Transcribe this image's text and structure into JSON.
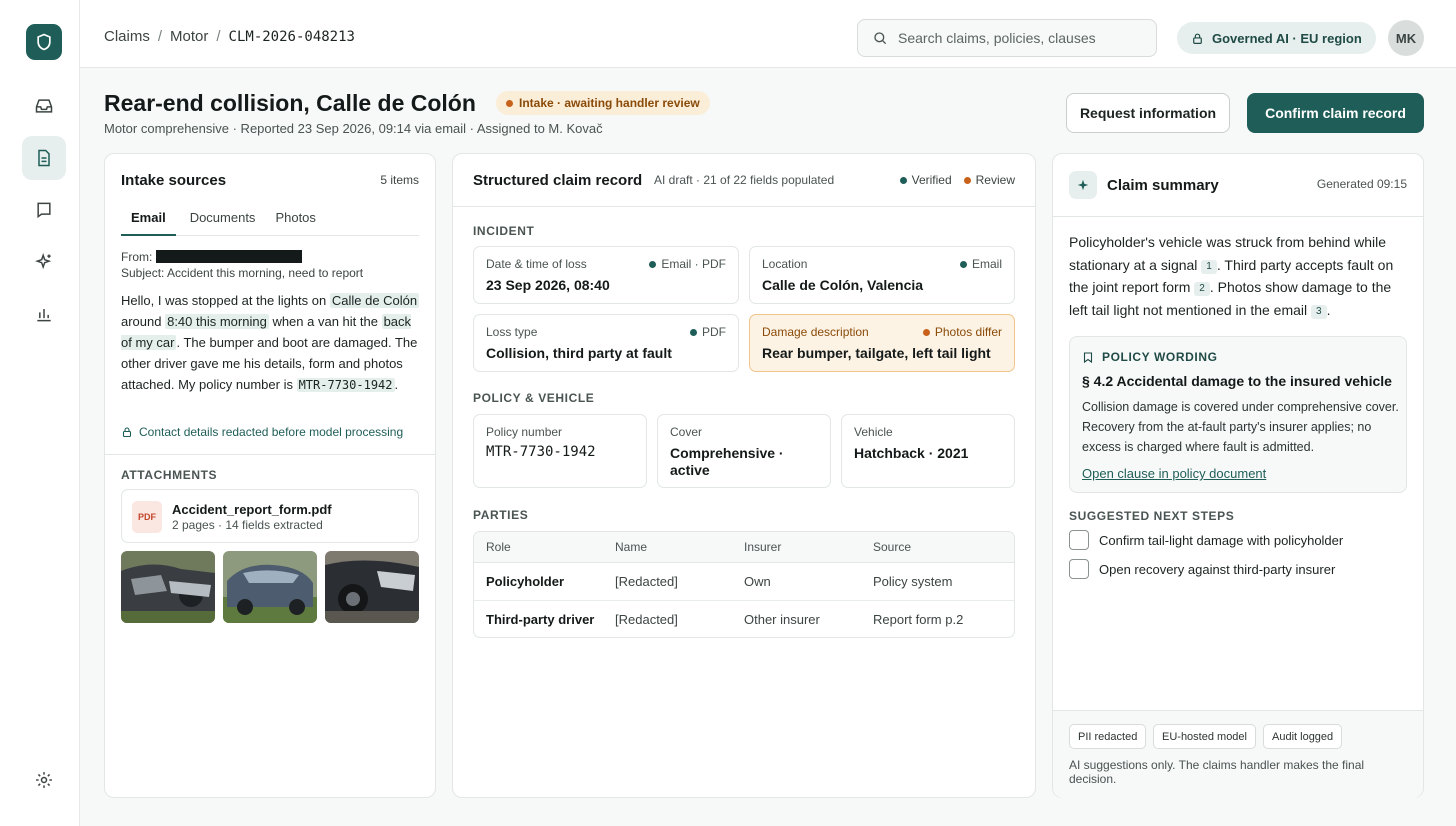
{
  "breadcrumb": {
    "items": [
      "Claims",
      "Motor"
    ],
    "current": "CLM-2026-048213"
  },
  "search": {
    "placeholder": "Search claims, policies, clauses"
  },
  "governance_pill": "Governed AI · EU region",
  "user": {
    "initials": "MK"
  },
  "rail": {
    "icons": [
      "shield-icon",
      "inbox-icon",
      "document-icon",
      "chat-icon",
      "sparkle-icon",
      "chart-icon",
      "gear-icon"
    ]
  },
  "claim": {
    "title": "Rear-end collision, Calle de Colón",
    "status": "Intake · awaiting handler review",
    "subtitle": "Motor comprehensive · Reported 23 Sep 2026, 09:14 via email · Assigned to M. Kovač"
  },
  "actions": {
    "request_info": "Request information",
    "confirm": "Confirm claim record"
  },
  "intake": {
    "title": "Intake sources",
    "count": "5 items",
    "tabs": [
      "Email",
      "Documents",
      "Photos"
    ],
    "from_label": "From:",
    "subject": "Subject: Accident this morning, need to report",
    "body": {
      "t1": "Hello, I was stopped at the lights on ",
      "h1": "Calle de Colón",
      "t2": " around ",
      "h2": "8:40 this morning",
      "t3": " when a van hit the ",
      "h3": "back of my car",
      "t4": ". The bumper and boot are damaged. The other driver gave me his details, form and photos attached. My policy number is ",
      "policy": "MTR-7730-1942",
      "t5": "."
    },
    "redaction_note": "Contact details redacted before model processing",
    "attachments_label": "ATTACHMENTS",
    "attachment": {
      "badge": "PDF",
      "name": "Accident_report_form.pdf",
      "meta": "2 pages · 14 fields extracted"
    }
  },
  "record": {
    "title": "Structured claim record",
    "meta": "AI draft · 21 of 22 fields populated",
    "legend": {
      "verified": "Verified",
      "review": "Review"
    },
    "incident_label": "INCIDENT",
    "incident": [
      {
        "label": "Date & time of loss",
        "source": "Email · PDF",
        "value": "23 Sep 2026, 08:40"
      },
      {
        "label": "Location",
        "source": "Email",
        "value": "Calle de Colón, Valencia"
      },
      {
        "label": "Loss type",
        "source": "PDF",
        "value": "Collision, third party at fault"
      },
      {
        "label": "Damage description",
        "source": "Photos differ",
        "value": "Rear bumper, tailgate, left tail light"
      }
    ],
    "policy_label": "POLICY & VEHICLE",
    "policy": [
      {
        "label": "Policy number",
        "value": "MTR-7730-1942"
      },
      {
        "label": "Cover",
        "value": "Comprehensive · active"
      },
      {
        "label": "Vehicle",
        "value": "Hatchback · 2021"
      }
    ],
    "parties_label": "PARTIES",
    "parties_headers": [
      "Role",
      "Name",
      "Insurer",
      "Source"
    ],
    "parties": [
      {
        "role": "Policyholder",
        "name": "[Redacted]",
        "insurer": "Own",
        "source": "Policy system"
      },
      {
        "role": "Third-party driver",
        "name": "[Redacted]",
        "insurer": "Other insurer",
        "source": "Report form p.2"
      }
    ]
  },
  "summary": {
    "title": "Claim summary",
    "generated": "Generated 09:15",
    "text": {
      "s1": "Policyholder's vehicle was struck from behind while stationary at a signal ",
      "c1": "1",
      "s2": ". Third party accepts fault on the joint report form ",
      "c2": "2",
      "s3": ". Photos show damage to the left tail light not mentioned in the email ",
      "c3": "3",
      "s4": "."
    },
    "clause": {
      "label": "POLICY WORDING",
      "title": "§ 4.2 Accidental damage to the insured vehicle",
      "body": "Collision damage is covered under comprehensive cover. Recovery from the at-fault party's insurer applies; no excess is charged where fault is admitted.",
      "link": "Open clause in policy document"
    },
    "steps_label": "SUGGESTED NEXT STEPS",
    "steps": [
      "Confirm tail-light damage with policyholder",
      "Open recovery against third-party insurer"
    ],
    "chips": [
      "PII redacted",
      "EU-hosted model",
      "Audit logged"
    ],
    "footnote": "AI suggestions only. The claims handler makes the final decision."
  },
  "colors": {
    "brand": "#1f5e58",
    "warning": "#c8621b",
    "warning_bg": "#fdf3e5"
  }
}
